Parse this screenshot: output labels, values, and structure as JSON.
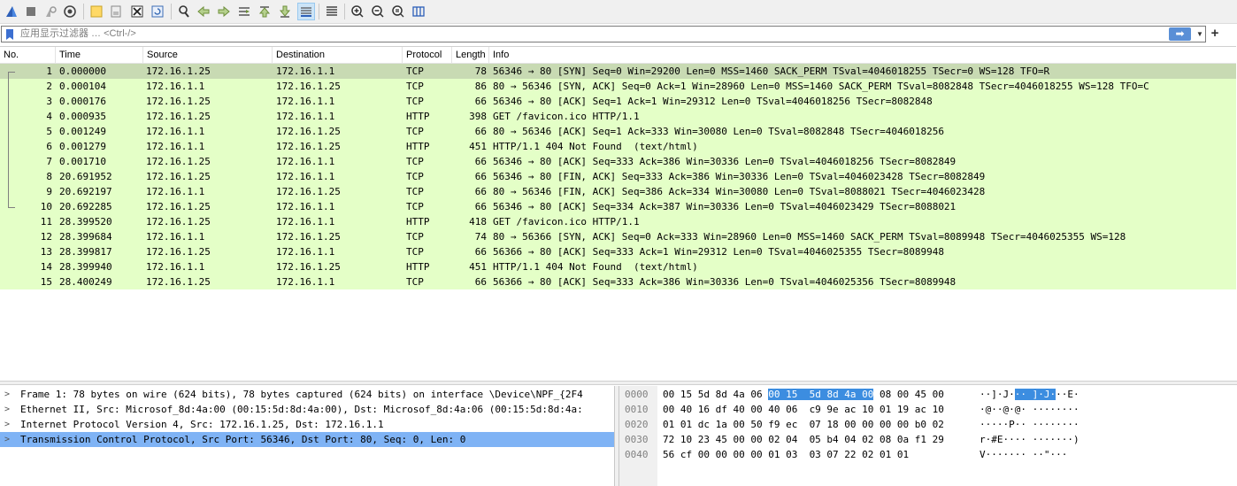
{
  "toolbar": {
    "icons": [
      "start-capture-icon",
      "stop-capture-icon",
      "restart-capture-icon",
      "capture-options-icon",
      "open-file-icon",
      "save-file-icon",
      "close-file-icon",
      "reload-file-icon",
      "find-packet-icon",
      "go-back-icon",
      "go-forward-icon",
      "go-to-packet-icon",
      "go-first-icon",
      "go-last-icon",
      "autoscroll-icon",
      "colorize-icon",
      "zoom-in-icon",
      "zoom-out-icon",
      "zoom-normal-icon",
      "resize-columns-icon"
    ]
  },
  "filter": {
    "placeholder": "应用显示过滤器 … <Ctrl-/>",
    "apply_arrow": "➡",
    "dropdown": "▼",
    "add": "+"
  },
  "packet_list": {
    "columns": {
      "no": "No.",
      "time": "Time",
      "source": "Source",
      "destination": "Destination",
      "protocol": "Protocol",
      "length": "Length",
      "info": "Info"
    },
    "rows": [
      {
        "no": "1",
        "time": "0.000000",
        "src": "172.16.1.25",
        "dst": "172.16.1.1",
        "proto": "TCP",
        "len": "78",
        "info": "56346 → 80 [SYN] Seq=0 Win=29200 Len=0 MSS=1460 SACK_PERM TSval=4046018255 TSecr=0 WS=128 TFO=R"
      },
      {
        "no": "2",
        "time": "0.000104",
        "src": "172.16.1.1",
        "dst": "172.16.1.25",
        "proto": "TCP",
        "len": "86",
        "info": "80 → 56346 [SYN, ACK] Seq=0 Ack=1 Win=28960 Len=0 MSS=1460 SACK_PERM TSval=8082848 TSecr=4046018255 WS=128 TFO=C"
      },
      {
        "no": "3",
        "time": "0.000176",
        "src": "172.16.1.25",
        "dst": "172.16.1.1",
        "proto": "TCP",
        "len": "66",
        "info": "56346 → 80 [ACK] Seq=1 Ack=1 Win=29312 Len=0 TSval=4046018256 TSecr=8082848"
      },
      {
        "no": "4",
        "time": "0.000935",
        "src": "172.16.1.25",
        "dst": "172.16.1.1",
        "proto": "HTTP",
        "len": "398",
        "info": "GET /favicon.ico HTTP/1.1"
      },
      {
        "no": "5",
        "time": "0.001249",
        "src": "172.16.1.1",
        "dst": "172.16.1.25",
        "proto": "TCP",
        "len": "66",
        "info": "80 → 56346 [ACK] Seq=1 Ack=333 Win=30080 Len=0 TSval=8082848 TSecr=4046018256"
      },
      {
        "no": "6",
        "time": "0.001279",
        "src": "172.16.1.1",
        "dst": "172.16.1.25",
        "proto": "HTTP",
        "len": "451",
        "info": "HTTP/1.1 404 Not Found  (text/html)"
      },
      {
        "no": "7",
        "time": "0.001710",
        "src": "172.16.1.25",
        "dst": "172.16.1.1",
        "proto": "TCP",
        "len": "66",
        "info": "56346 → 80 [ACK] Seq=333 Ack=386 Win=30336 Len=0 TSval=4046018256 TSecr=8082849"
      },
      {
        "no": "8",
        "time": "20.691952",
        "src": "172.16.1.25",
        "dst": "172.16.1.1",
        "proto": "TCP",
        "len": "66",
        "info": "56346 → 80 [FIN, ACK] Seq=333 Ack=386 Win=30336 Len=0 TSval=4046023428 TSecr=8082849"
      },
      {
        "no": "9",
        "time": "20.692197",
        "src": "172.16.1.1",
        "dst": "172.16.1.25",
        "proto": "TCP",
        "len": "66",
        "info": "80 → 56346 [FIN, ACK] Seq=386 Ack=334 Win=30080 Len=0 TSval=8088021 TSecr=4046023428"
      },
      {
        "no": "10",
        "time": "20.692285",
        "src": "172.16.1.25",
        "dst": "172.16.1.1",
        "proto": "TCP",
        "len": "66",
        "info": "56346 → 80 [ACK] Seq=334 Ack=387 Win=30336 Len=0 TSval=4046023429 TSecr=8088021"
      },
      {
        "no": "11",
        "time": "28.399520",
        "src": "172.16.1.25",
        "dst": "172.16.1.1",
        "proto": "HTTP",
        "len": "418",
        "info": "GET /favicon.ico HTTP/1.1"
      },
      {
        "no": "12",
        "time": "28.399684",
        "src": "172.16.1.1",
        "dst": "172.16.1.25",
        "proto": "TCP",
        "len": "74",
        "info": "80 → 56366 [SYN, ACK] Seq=0 Ack=333 Win=28960 Len=0 MSS=1460 SACK_PERM TSval=8089948 TSecr=4046025355 WS=128"
      },
      {
        "no": "13",
        "time": "28.399817",
        "src": "172.16.1.25",
        "dst": "172.16.1.1",
        "proto": "TCP",
        "len": "66",
        "info": "56366 → 80 [ACK] Seq=333 Ack=1 Win=29312 Len=0 TSval=4046025355 TSecr=8089948"
      },
      {
        "no": "14",
        "time": "28.399940",
        "src": "172.16.1.1",
        "dst": "172.16.1.25",
        "proto": "HTTP",
        "len": "451",
        "info": "HTTP/1.1 404 Not Found  (text/html)"
      },
      {
        "no": "15",
        "time": "28.400249",
        "src": "172.16.1.25",
        "dst": "172.16.1.1",
        "proto": "TCP",
        "len": "66",
        "info": "56366 → 80 [ACK] Seq=333 Ack=386 Win=30336 Len=0 TSval=4046025356 TSecr=8089948"
      }
    ]
  },
  "details": {
    "rows": [
      {
        "text": "Frame 1: 78 bytes on wire (624 bits), 78 bytes captured (624 bits) on interface \\Device\\NPF_{2F4",
        "selected": false
      },
      {
        "text": "Ethernet II, Src: Microsof_8d:4a:00 (00:15:5d:8d:4a:00), Dst: Microsof_8d:4a:06 (00:15:5d:8d:4a:",
        "selected": false
      },
      {
        "text": "Internet Protocol Version 4, Src: 172.16.1.25, Dst: 172.16.1.1",
        "selected": false
      },
      {
        "text": "Transmission Control Protocol, Src Port: 56346, Dst Port: 80, Seq: 0, Len: 0",
        "selected": true
      }
    ],
    "expander": ">"
  },
  "bytes": {
    "rows": [
      {
        "offset": "0000",
        "hex_pre": "00 15 5d 8d 4a 06 ",
        "hex_hl": "00 15  5d 8d 4a 00",
        "hex_post": " 08 00 45 00",
        "ascii_pre": "··]·J·",
        "ascii_hl": "·· ]·J·",
        "ascii_post": "··E·"
      },
      {
        "offset": "0010",
        "hex_pre": "00 40 16 df 40 00 40 06  c9 9e ac 10 01 19 ac 10",
        "hex_hl": "",
        "hex_post": "",
        "ascii_pre": "·@··@·@· ········",
        "ascii_hl": "",
        "ascii_post": ""
      },
      {
        "offset": "0020",
        "hex_pre": "01 01 dc 1a 00 50 f9 ec  07 18 00 00 00 00 b0 02",
        "hex_hl": "",
        "hex_post": "",
        "ascii_pre": "·····P·· ········",
        "ascii_hl": "",
        "ascii_post": ""
      },
      {
        "offset": "0030",
        "hex_pre": "72 10 23 45 00 00 02 04  05 b4 04 02 08 0a f1 29",
        "hex_hl": "",
        "hex_post": "",
        "ascii_pre": "r·#E···· ·······)",
        "ascii_hl": "",
        "ascii_post": ""
      },
      {
        "offset": "0040",
        "hex_pre": "56 cf 00 00 00 00 01 03  03 07 22 02 01 01",
        "hex_hl": "",
        "hex_post": "",
        "ascii_pre": "V······· ··\"···",
        "ascii_hl": "",
        "ascii_post": ""
      }
    ]
  },
  "colors": {
    "row_tcp_http": "#e4ffc7",
    "row_selected": "#c8dab3",
    "detail_selected": "#7fb3f5",
    "byte_highlight": "#3c8de0"
  }
}
